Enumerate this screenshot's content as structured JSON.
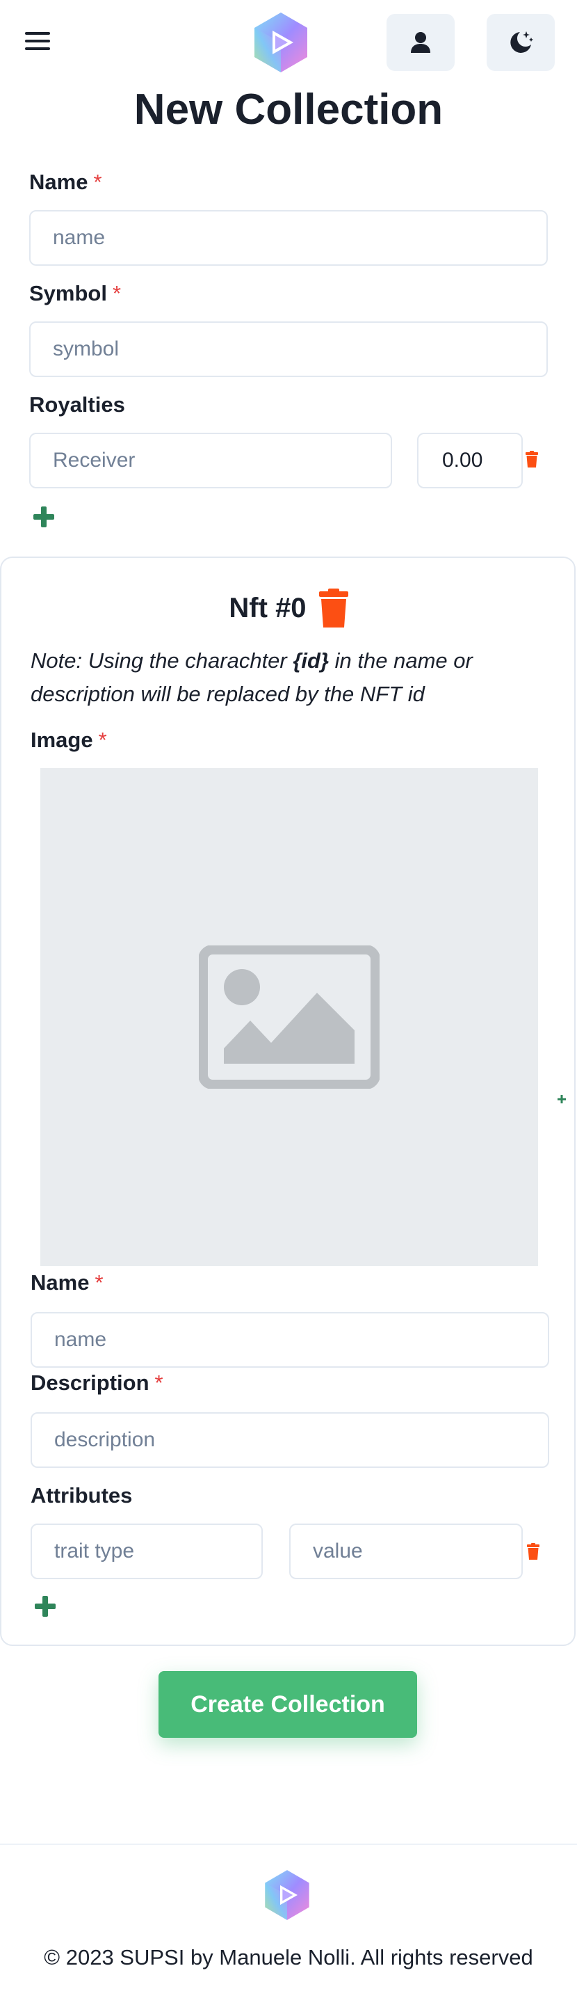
{
  "header": {
    "menu_icon": "hamburger-menu-icon",
    "logo_icon": "app-logo-icon",
    "user_icon": "user-icon",
    "theme_icon": "moon-stars-icon"
  },
  "page": {
    "title": "New Collection"
  },
  "collection": {
    "name_label": "Name",
    "name_placeholder": "name",
    "symbol_label": "Symbol",
    "symbol_placeholder": "symbol",
    "required_mark": "*",
    "royalties_label": "Royalties",
    "receiver_placeholder": "Receiver",
    "royalty_value": "0.00"
  },
  "nft": {
    "title": "Nft #0",
    "note_prefix": "Note: Using the charachter ",
    "note_token": "{id}",
    "note_suffix": " in the name or description will be replaced by the NFT id",
    "image_label": "Image",
    "name_label": "Name",
    "name_placeholder": "name",
    "description_label": "Description",
    "description_placeholder": "description",
    "attributes_label": "Attributes",
    "trait_type_placeholder": "trait type",
    "value_placeholder": "value"
  },
  "actions": {
    "create_label": "Create Collection"
  },
  "footer": {
    "copyright": "© 2023 SUPSI by Manuele Nolli. All rights reserved"
  },
  "colors": {
    "accent_green": "#48bb78",
    "plus_green": "#2f855a",
    "trash_orange": "#fc4f13",
    "required_red": "#e53e3e"
  }
}
